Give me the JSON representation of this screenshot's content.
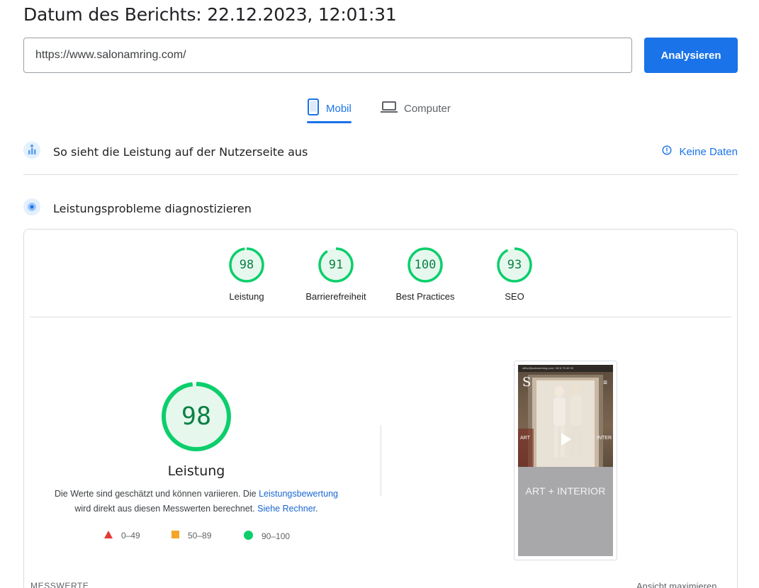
{
  "header": {
    "report_date": "Datum des Berichts: 22.12.2023, 12:01:31"
  },
  "search": {
    "url_value": "https://www.salonamring.com/",
    "analyze_label": "Analysieren"
  },
  "tabs": [
    {
      "label": "Mobil",
      "icon": "smartphone-icon",
      "active": true
    },
    {
      "label": "Computer",
      "icon": "laptop-icon",
      "active": false
    }
  ],
  "field_data": {
    "title": "So sieht die Leistung auf der Nutzerseite aus",
    "status": "Keine Daten"
  },
  "diagnose": {
    "title": "Leistungsprobleme diagnostizieren"
  },
  "scores": [
    {
      "label": "Leistung",
      "value": 98
    },
    {
      "label": "Barrierefreiheit",
      "value": 91
    },
    {
      "label": "Best Practices",
      "value": 100
    },
    {
      "label": "SEO",
      "value": 93
    }
  ],
  "main_score": {
    "value": 98,
    "label": "Leistung",
    "desc_part1": "Die Werte sind geschätzt und können variieren. Die ",
    "desc_link1": "Leistungsbewertung",
    "desc_part2": "wird direkt aus diesen Messwerten berechnet. ",
    "desc_link2": "Siehe Rechner",
    "desc_end": "."
  },
  "legend": [
    {
      "range": "0–49",
      "color": "#e53935"
    },
    {
      "range": "50–89",
      "color": "#f4a62a"
    },
    {
      "range": "90–100",
      "color": "#0cce6b"
    }
  ],
  "screenshot": {
    "topbar_text": "office@salonamring.com   +49 6 75 40 00",
    "logo_text": "S",
    "left_overlay": "ART",
    "right_overlay": "INTER",
    "banner_text": "ART + INTERIOR"
  },
  "footer": {
    "metrics_label": "MESSWERTE",
    "expand_label": "Ansicht maximieren"
  },
  "colors": {
    "accent": "#1a73e8",
    "good": "#0cce6b",
    "good_text": "#0b8043"
  }
}
